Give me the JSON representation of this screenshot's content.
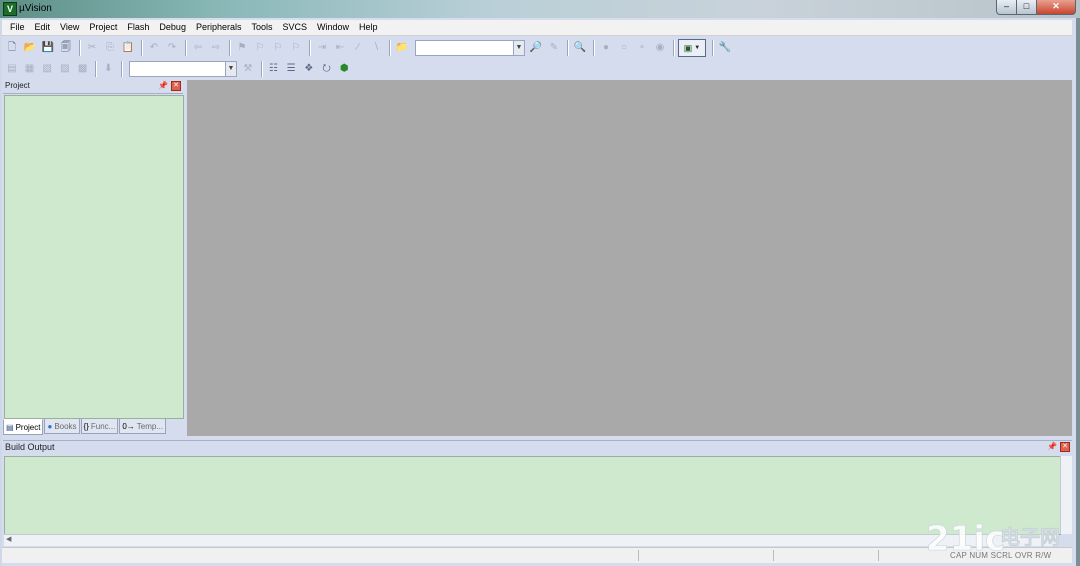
{
  "window": {
    "title": "µVision",
    "icon": "uvision-app-icon",
    "controls": [
      "minimize-icon",
      "maximize-icon",
      "close-icon"
    ]
  },
  "menubar": {
    "items": [
      {
        "label": "File"
      },
      {
        "label": "Edit"
      },
      {
        "label": "View"
      },
      {
        "label": "Project"
      },
      {
        "label": "Flash"
      },
      {
        "label": "Debug"
      },
      {
        "label": "Peripherals"
      },
      {
        "label": "Tools"
      },
      {
        "label": "SVCS"
      },
      {
        "label": "Window"
      },
      {
        "label": "Help"
      }
    ]
  },
  "toolbar1": {
    "find_combo_value": ""
  },
  "toolbar2": {
    "target_combo_value": ""
  },
  "project_panel": {
    "title": "Project",
    "tabs": [
      {
        "label": "Project",
        "icon": "project-tab-icon",
        "active": true
      },
      {
        "label": "Books",
        "icon": "books-tab-icon",
        "active": false
      },
      {
        "label": "Func...",
        "icon": "functions-tab-icon",
        "active": false
      },
      {
        "label": "Temp...",
        "icon": "templates-tab-icon",
        "active": false
      }
    ]
  },
  "build_output": {
    "title": "Build Output"
  },
  "statusbar": {
    "indicators": "CAP  NUM  SCRL  OVR  R/W"
  },
  "watermark": {
    "text": "21ic电子网"
  },
  "colors": {
    "panel_green": "#cfe9cf",
    "editor_gray": "#a9a9a9",
    "frame_blue": "#d4dcee"
  }
}
